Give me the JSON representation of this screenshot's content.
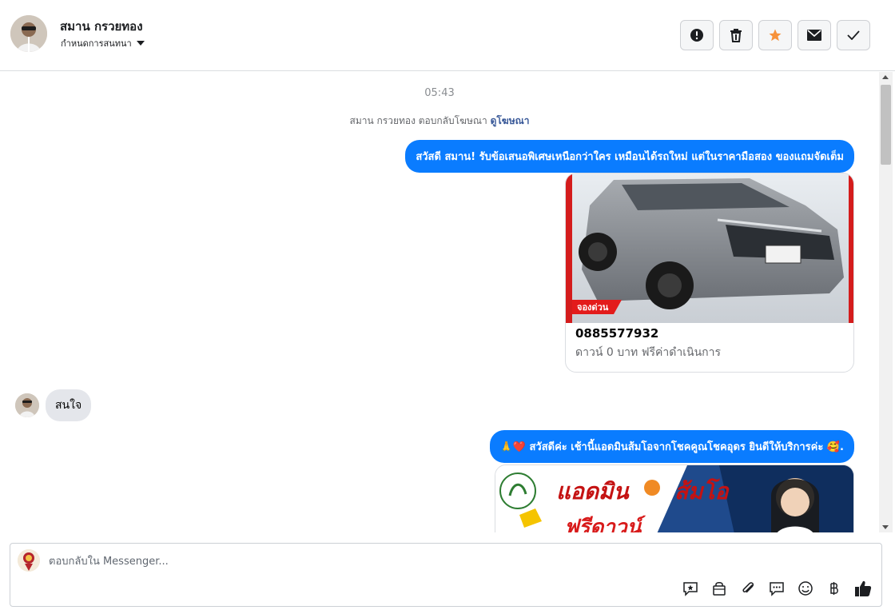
{
  "header": {
    "contact_name": "สมาน กรวยทอง",
    "assign_label": "กำหนดการสนทนา",
    "actions": [
      {
        "name": "mark-spam-button",
        "icon": "alert-circle-icon"
      },
      {
        "name": "delete-button",
        "icon": "trash-icon"
      },
      {
        "name": "star-button",
        "icon": "star-icon",
        "accent": "#f7923b"
      },
      {
        "name": "mark-unread-button",
        "icon": "envelope-icon"
      },
      {
        "name": "mark-done-button",
        "icon": "check-icon"
      }
    ]
  },
  "chat": {
    "timestamp": "05:43",
    "reply_note": {
      "text": "สมาน กรวยทอง ตอบกลับโฆษณา ",
      "link": "ดูโฆษณา"
    },
    "messages": [
      {
        "type": "outgoing",
        "text": "สวัสดี สมาน! รับข้อเสนอพิเศษเหนือกว่าใคร เหมือนได้รถใหม่ แต่ในราคามือสอง ของแถมจัดเต็ม"
      },
      {
        "type": "card",
        "title": "0885577932",
        "description": "ดาวน์ 0 บาท ฟรีค่าดำเนินการ",
        "image_overlay_text": "จองด่วน"
      },
      {
        "type": "incoming",
        "text": "สนใจ"
      },
      {
        "type": "outgoing",
        "text": "🙏❤️ สวัสดีค่ะ เช้านี้แอดมินส้มโอจากโชคคูณโชคอุดร ยินดีให้บริการค่ะ 🥰."
      },
      {
        "type": "banner",
        "headline": "แอดมิน",
        "headline2": "ส้มโอ",
        "badge": "ฟรีดาวน์"
      }
    ]
  },
  "composer": {
    "placeholder": "ตอบกลับใน Messenger...",
    "tools": [
      "saved-reply-icon",
      "shopping-bag-icon",
      "paperclip-icon",
      "chat-bubble-icon",
      "emoji-icon",
      "baht-icon",
      "like-icon"
    ]
  },
  "colors": {
    "outgoing_bubble": "#0a7cff",
    "incoming_bubble": "#e4e6eb",
    "link": "#385898",
    "star": "#f7923b"
  }
}
